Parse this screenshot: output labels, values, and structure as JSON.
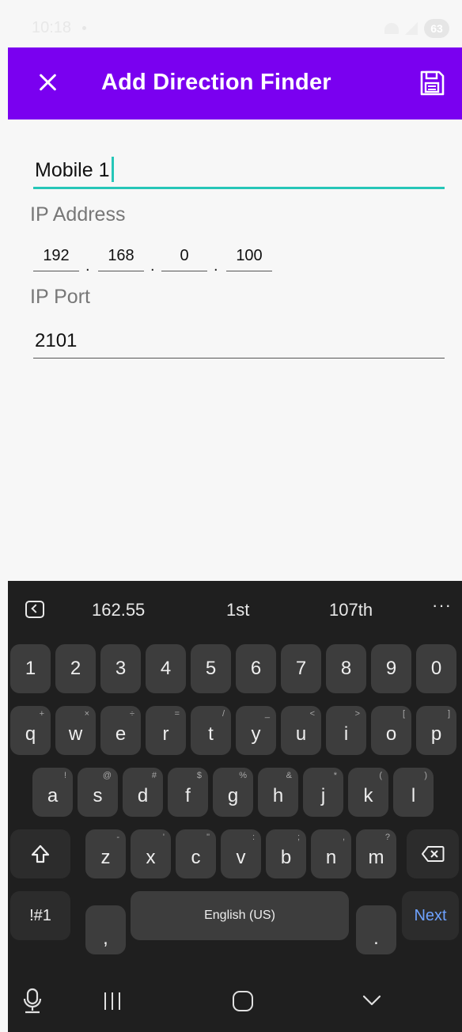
{
  "status_bar": {
    "time": "10:18",
    "battery": "63"
  },
  "app_bar": {
    "title": "Add Direction Finder"
  },
  "form": {
    "name_value": "Mobile 1",
    "ip_label": "IP Address",
    "ip_octets": [
      "192",
      "168",
      "0",
      "100"
    ],
    "ip_separator": ".",
    "port_label": "IP Port",
    "port_value": "2101"
  },
  "keyboard": {
    "suggestions": [
      "162.55",
      "1st",
      "107th"
    ],
    "more": "···",
    "number_row": [
      "1",
      "2",
      "3",
      "4",
      "5",
      "6",
      "7",
      "8",
      "9",
      "0"
    ],
    "row1": [
      {
        "key": "q",
        "hint": "+"
      },
      {
        "key": "w",
        "hint": "×"
      },
      {
        "key": "e",
        "hint": "÷"
      },
      {
        "key": "r",
        "hint": "="
      },
      {
        "key": "t",
        "hint": "/"
      },
      {
        "key": "y",
        "hint": "_"
      },
      {
        "key": "u",
        "hint": "<"
      },
      {
        "key": "i",
        "hint": ">"
      },
      {
        "key": "o",
        "hint": "["
      },
      {
        "key": "p",
        "hint": "]"
      }
    ],
    "row2": [
      {
        "key": "a",
        "hint": "!"
      },
      {
        "key": "s",
        "hint": "@"
      },
      {
        "key": "d",
        "hint": "#"
      },
      {
        "key": "f",
        "hint": "$"
      },
      {
        "key": "g",
        "hint": "%"
      },
      {
        "key": "h",
        "hint": "&"
      },
      {
        "key": "j",
        "hint": "*"
      },
      {
        "key": "k",
        "hint": "("
      },
      {
        "key": "l",
        "hint": ")"
      }
    ],
    "row3": [
      {
        "key": "z",
        "hint": "-"
      },
      {
        "key": "x",
        "hint": "'"
      },
      {
        "key": "c",
        "hint": "\""
      },
      {
        "key": "v",
        "hint": ":"
      },
      {
        "key": "b",
        "hint": ";"
      },
      {
        "key": "n",
        "hint": ","
      },
      {
        "key": "m",
        "hint": "?"
      }
    ],
    "symbols_label": "!#1",
    "comma_label": ",",
    "space_label": "English (US)",
    "period_label": ".",
    "next_label": "Next"
  },
  "colors": {
    "accent": "#7a00f0",
    "focus_underline": "#26c6b8",
    "next_key": "#6ea2ff"
  },
  "icons": [
    "close-icon",
    "save-icon",
    "collapse-keyboard-icon",
    "shift-icon",
    "backspace-icon",
    "microphone-icon",
    "recents-icon",
    "home-icon",
    "back-icon"
  ]
}
